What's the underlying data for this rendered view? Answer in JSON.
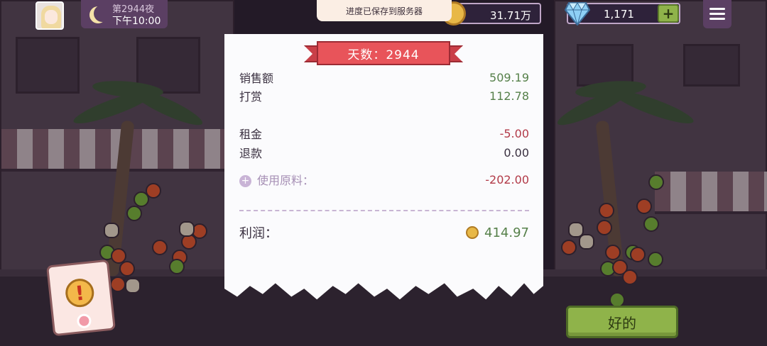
{
  "hud": {
    "night_label": "第2944夜",
    "time": "下午10:00",
    "coins": "31.71万",
    "gems": "1,171",
    "gem_add": "+"
  },
  "toast": {
    "text": "进度已保存到服务器"
  },
  "receipt": {
    "day_banner": "天数：2944",
    "rows": [
      {
        "label": "销售额",
        "value": "509.19",
        "color": "#56804a"
      },
      {
        "label": "打赏",
        "value": "112.78",
        "color": "#56804a"
      },
      {
        "label": "租金",
        "value": "-5.00",
        "color": "#b23a48"
      },
      {
        "label": "退款",
        "value": "0.00",
        "color": "#3a3040"
      },
      {
        "label": "使用原料：",
        "value": "-202.00",
        "color": "#b23a48"
      }
    ],
    "profit_label": "利润：",
    "profit_value": "414.97"
  },
  "buttons": {
    "ok": "好的"
  },
  "icons": {
    "avatar": "avatar",
    "moon": "moon-icon",
    "coin": "coin-icon",
    "gem": "diamond-icon",
    "menu": "hamburger-menu-icon",
    "alert": "exclamation-alert-icon",
    "expand": "plus-circle-icon"
  }
}
